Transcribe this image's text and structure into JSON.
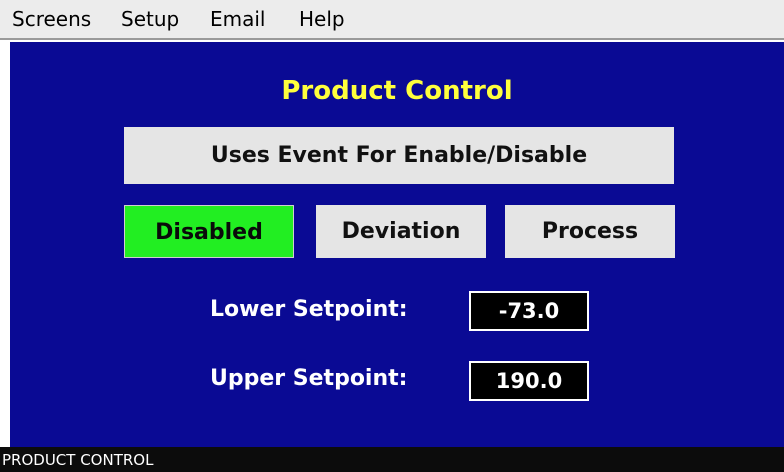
{
  "menu": {
    "items": [
      "Screens",
      "Setup",
      "Email",
      "Help"
    ]
  },
  "screen": {
    "title": "Product Control",
    "event_button": "Uses Event For Enable/Disable",
    "modes": [
      {
        "label": "Disabled",
        "active": true
      },
      {
        "label": "Deviation",
        "active": false
      },
      {
        "label": "Process",
        "active": false
      }
    ],
    "lower_setpoint": {
      "label": "Lower Setpoint:",
      "value": "-73.0"
    },
    "upper_setpoint": {
      "label": "Upper Setpoint:",
      "value": "190.0"
    }
  },
  "status": {
    "text": "PRODUCT CONTROL"
  },
  "colors": {
    "screen_background": "#0a0a94",
    "title": "#ffff3c",
    "active_mode": "#22ee22",
    "button": "#e5e5e5"
  }
}
